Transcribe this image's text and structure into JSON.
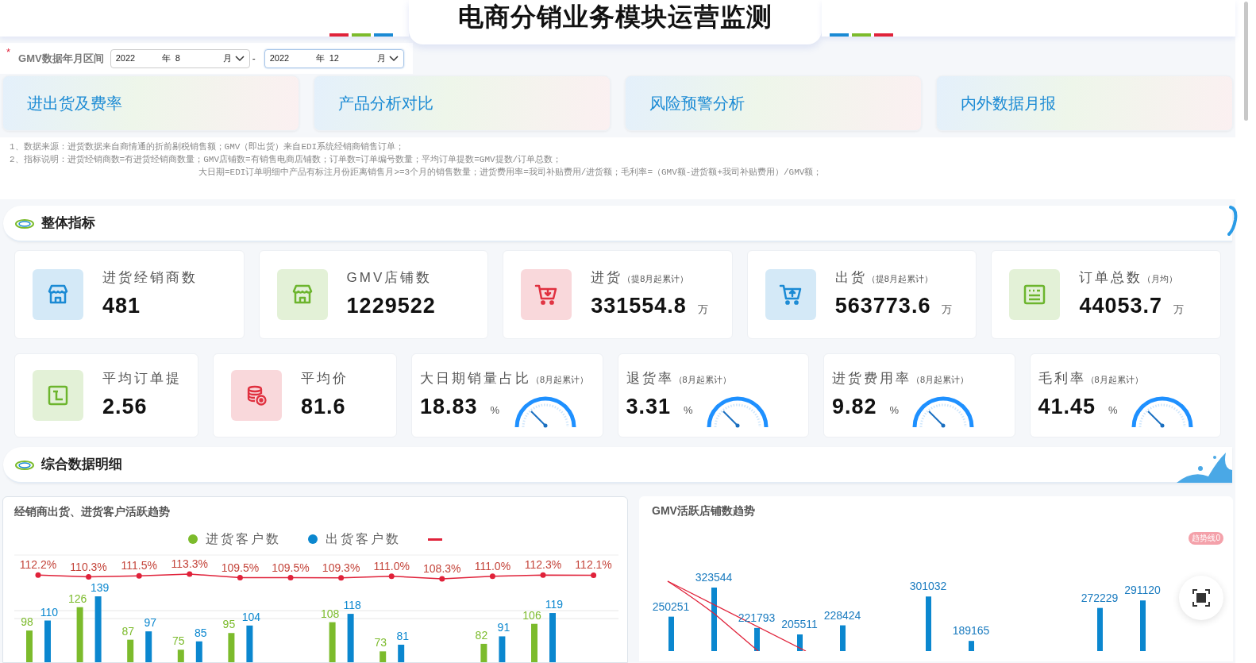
{
  "title": "电商分销业务模块运营监测",
  "filter": {
    "required_mark": "*",
    "label": "GMV数据年月区间",
    "separator": "-",
    "ranges": [
      {
        "year": "2022",
        "year_unit": "年",
        "month": "8",
        "month_unit": "月",
        "focused": false
      },
      {
        "year": "2022",
        "year_unit": "年",
        "month": "12",
        "month_unit": "月",
        "focused": true
      }
    ]
  },
  "tabs": [
    {
      "label": "进出货及费率"
    },
    {
      "label": "产品分析对比"
    },
    {
      "label": "风险预警分析"
    },
    {
      "label": "内外数据月报"
    }
  ],
  "notes": [
    {
      "lines": [
        "1、数据来源：进货数据来自商情通的折前剔税销售额；GMV（即出货）来自EDI系统经销商销售订单；"
      ]
    },
    {
      "lines": [
        "2、指标说明：进货经销商数=有进货经销商数量；GMV店铺数=有销售电商店铺数；订单数=订单编号数量；平均订单提数=GMV提数/订单总数；",
        "大日期=EDI订单明细中产品有标注月份距离销售月>=3个月的销售数量；进货费用率=我司补贴费用/进货额；毛利率=（GMV额-进货额+我司补贴费用）/GMV额；"
      ]
    }
  ],
  "overview": {
    "title": "整体指标",
    "row1": [
      {
        "label": "进货经销商数",
        "value": "481",
        "color": "#1a8ad4"
      },
      {
        "label": "GMV店铺数",
        "value": "1229522",
        "color": "#6cb52d"
      },
      {
        "label": "进货",
        "note": "（提8月起累计）",
        "value": "331554.8",
        "unit": "万",
        "color": "#e0303f"
      },
      {
        "label": "出货",
        "note": "（提8月起累计）",
        "value": "563773.6",
        "unit": "万",
        "color": "#1a8ad4"
      },
      {
        "label": "订单总数",
        "note": "（月均）",
        "value": "44053.7",
        "unit": "万",
        "color": "#6cb52d"
      }
    ],
    "row2": [
      {
        "kind": "icon",
        "label": "平均订单提",
        "value": "2.56",
        "color": "#6cb52d"
      },
      {
        "kind": "icon",
        "label": "平均价",
        "value": "81.6",
        "color": "#e0303f"
      },
      {
        "kind": "gauge",
        "label": "大日期销量占比",
        "note": "（8月起累计）",
        "value": "18.83",
        "unit": "%"
      },
      {
        "kind": "gauge",
        "label": "退货率",
        "note": "（8月起累计）",
        "value": "3.31",
        "unit": "%"
      },
      {
        "kind": "gauge",
        "label": "进货费用率",
        "note": "（8月起累计）",
        "value": "9.82",
        "unit": "%"
      },
      {
        "kind": "gauge",
        "label": "毛利率",
        "note": "（8月起累计）",
        "value": "41.45",
        "unit": "%"
      }
    ]
  },
  "details": {
    "title": "综合数据明细",
    "customer_chart": {
      "title": "经销商出货、进货客户活跃趋势",
      "legend": [
        {
          "label": "进货客户数",
          "color": "#7cbb2c"
        },
        {
          "label": "出货客户数",
          "color": "#0b87cf"
        },
        {
          "color": "#e0223a"
        }
      ],
      "groups": [
        {
          "inbound": "98",
          "outbound": "110",
          "rate": "112.2%"
        },
        {
          "inbound": "126",
          "outbound": "139",
          "rate": "110.3%"
        },
        {
          "inbound": "87",
          "outbound": "97",
          "rate": "111.5%"
        },
        {
          "inbound": "75",
          "outbound": "85",
          "rate": "113.3%"
        },
        {
          "inbound": "95",
          "outbound": "104",
          "rate": "109.5%"
        },
        {
          "rate": "109.5%"
        },
        {
          "inbound": "108",
          "outbound": "118",
          "rate": "109.3%"
        },
        {
          "inbound": "73",
          "outbound": "81",
          "rate": "111.0%"
        },
        {
          "rate": "108.3%"
        },
        {
          "inbound": "82",
          "outbound": "91",
          "rate": "111.0%"
        },
        {
          "inbound": "106",
          "outbound": "119",
          "rate": "112.3%"
        },
        {
          "rate": "112.1%"
        }
      ]
    },
    "store_chart": {
      "title": "GMV活跃店铺数趋势",
      "badge": "趋势线0",
      "bars": [
        {
          "kind": "bar",
          "label": "250251"
        },
        {
          "kind": "bar",
          "label": "323544"
        },
        {
          "kind": "bar",
          "label": "221793"
        },
        {
          "kind": "bar",
          "label": "205511"
        },
        {
          "kind": "bar",
          "label": "228424"
        },
        {
          "kind": "gap"
        },
        {
          "kind": "bar",
          "label": "301032"
        },
        {
          "kind": "bar",
          "label": "189165"
        },
        {
          "kind": "gap"
        },
        {
          "kind": "gap"
        },
        {
          "kind": "bar",
          "label": "272229"
        },
        {
          "kind": "bar",
          "label": "291120"
        }
      ]
    }
  }
}
